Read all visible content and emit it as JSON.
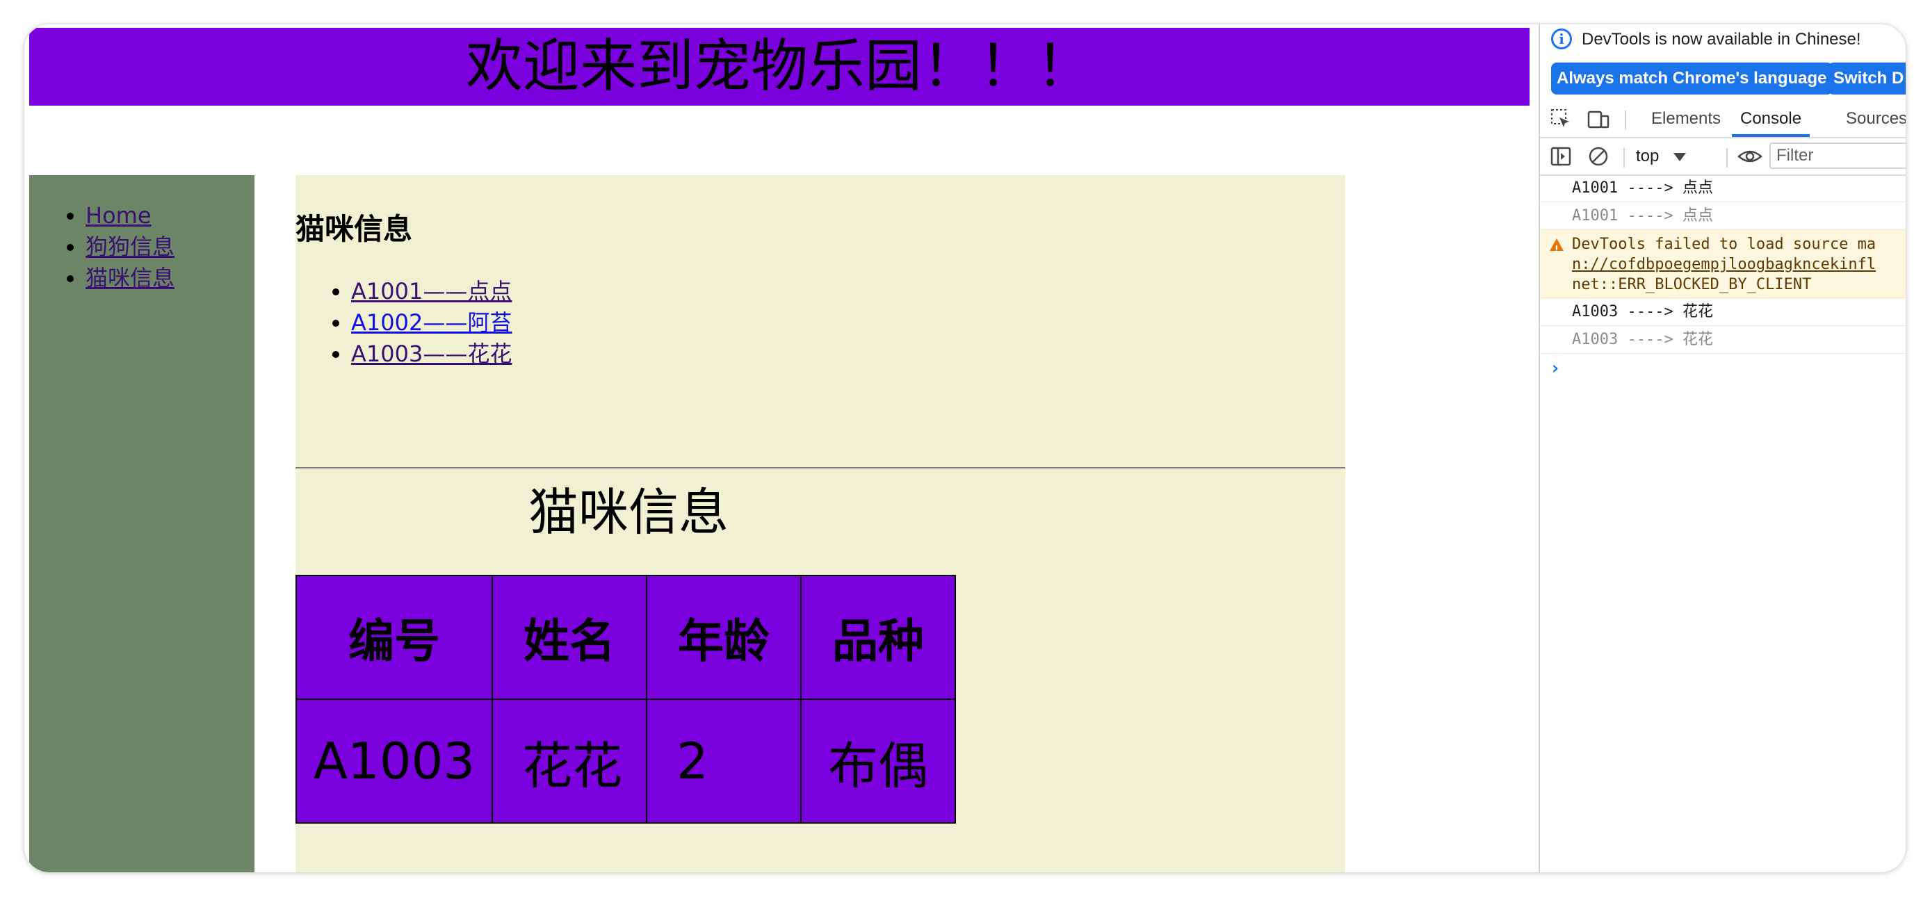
{
  "page": {
    "banner_text": "欢迎来到宠物乐园！！！",
    "sidebar": {
      "items": [
        {
          "label": "Home"
        },
        {
          "label": "狗狗信息"
        },
        {
          "label": "猫咪信息"
        }
      ]
    },
    "content": {
      "heading": "猫咪信息",
      "cat_links": [
        {
          "label": "A1001——点点"
        },
        {
          "label": "A1002——阿苔"
        },
        {
          "label": "A1003——花花"
        }
      ],
      "table_title": "猫咪信息",
      "table": {
        "headers": [
          "编号",
          "姓名",
          "年龄",
          "品种"
        ],
        "row": [
          "A1003",
          "花花",
          "2",
          "布偶"
        ]
      }
    },
    "colors": {
      "banner": "#7a00dd",
      "sidebar": "#6b8566",
      "content_bg": "#f0f0d2",
      "table_bg": "#7a00dd"
    }
  },
  "devtools": {
    "notice": "DevTools is now available in Chinese!",
    "btn_match": "Always match Chrome's language",
    "btn_switch": "Switch D",
    "tabs": [
      "Elements",
      "Console",
      "Sources"
    ],
    "active_tab": "Console",
    "context": "top",
    "filter_placeholder": "Filter",
    "console": {
      "line1": "A1001 ----> 点点",
      "line2": "A1001 ----> 点点",
      "warn1": "DevTools failed to load source ma",
      "warn2": "n://cofdbpoegempjloogbagkncekinfl",
      "warn3": "net::ERR_BLOCKED_BY_CLIENT",
      "line3": "A1003 ----> 花花",
      "line4": "A1003 ----> 花花"
    },
    "icons": [
      "info-icon",
      "inspect-icon",
      "device-toolbar-icon",
      "sidebar-toggle-icon",
      "clear-console-icon",
      "dropdown-arrow-icon",
      "eye-icon",
      "warning-icon",
      "prompt-chevron-icon"
    ]
  }
}
